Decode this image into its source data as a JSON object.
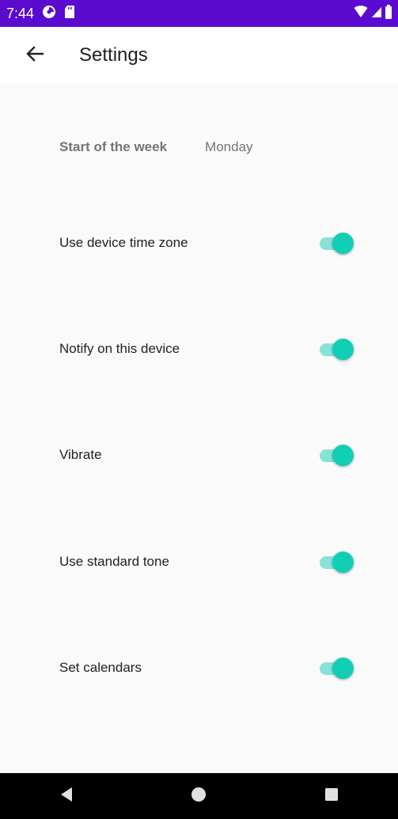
{
  "status_bar": {
    "time": "7:44",
    "background_color": "#5b0bd0",
    "left_icons": [
      "data-saver-icon",
      "sd-card-icon"
    ],
    "right_icons": [
      "wifi-icon",
      "cell-signal-icon",
      "battery-icon"
    ]
  },
  "app_bar": {
    "title": "Settings",
    "back_icon": "arrow-left-icon"
  },
  "settings": {
    "start_of_week": {
      "label": "Start of the week",
      "value": "Monday"
    },
    "toggles": [
      {
        "label": "Use device time zone",
        "on": true
      },
      {
        "label": "Notify on this device",
        "on": true
      },
      {
        "label": "Vibrate",
        "on": true
      },
      {
        "label": "Use standard tone",
        "on": true
      },
      {
        "label": "Set calendars",
        "on": true
      }
    ],
    "accent_color": "#10cfb6"
  },
  "nav_bar": {
    "buttons": [
      "back-triangle-icon",
      "home-circle-icon",
      "recents-square-icon"
    ]
  }
}
